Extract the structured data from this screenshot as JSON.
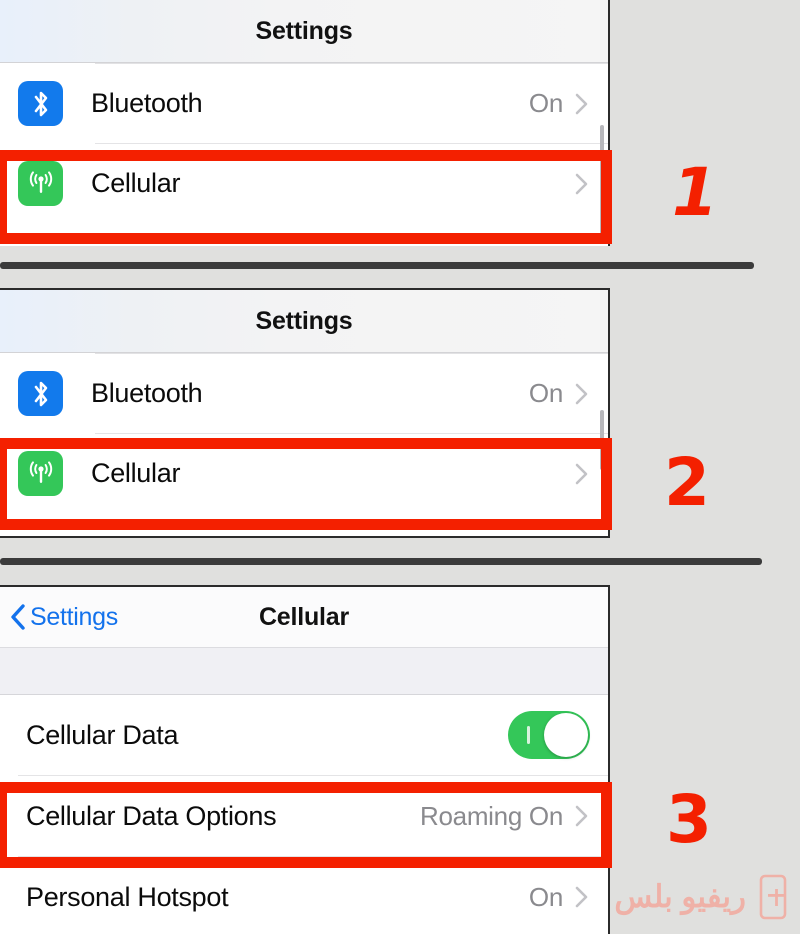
{
  "accent": {
    "highlight_red": "#f42000",
    "link_blue": "#1372ec",
    "toggle_green": "#34c759",
    "bluetooth_blue": "#127aec",
    "value_gray": "#8a8a8e",
    "page_background": "#e0e0de"
  },
  "panels": [
    {
      "id": "settings-step-1",
      "step_number": "1",
      "navbar": {
        "title": "Settings"
      },
      "rows": [
        {
          "icon": "bluetooth-icon",
          "label": "Bluetooth",
          "value": "On",
          "accessory": "chevron-right-icon"
        },
        {
          "icon": "cellular-icon",
          "label": "Cellular",
          "value": "",
          "accessory": "chevron-right-icon"
        }
      ],
      "highlighted_row_label": "Cellular"
    },
    {
      "id": "settings-step-2",
      "step_number": "2",
      "navbar": {
        "title": "Settings"
      },
      "rows": [
        {
          "icon": "bluetooth-icon",
          "label": "Bluetooth",
          "value": "On",
          "accessory": "chevron-right-icon"
        },
        {
          "icon": "cellular-icon",
          "label": "Cellular",
          "value": "",
          "accessory": "chevron-right-icon"
        }
      ],
      "highlighted_row_label": "Cellular"
    },
    {
      "id": "cellular-step-3",
      "step_number": "3",
      "navbar": {
        "back_label": "Settings",
        "title": "Cellular"
      },
      "rows": [
        {
          "icon": "",
          "label": "Cellular Data",
          "value": "",
          "accessory": "toggle-switch-on"
        },
        {
          "icon": "",
          "label": "Cellular Data Options",
          "value": "Roaming On",
          "accessory": "chevron-right-icon"
        },
        {
          "icon": "",
          "label": "Personal Hotspot",
          "value": "On",
          "accessory": "chevron-right-icon"
        }
      ],
      "highlighted_row_label": "Cellular Data Options"
    }
  ],
  "watermark": {
    "text": "ريفيو بلس",
    "logo": "phone-plus-icon"
  }
}
